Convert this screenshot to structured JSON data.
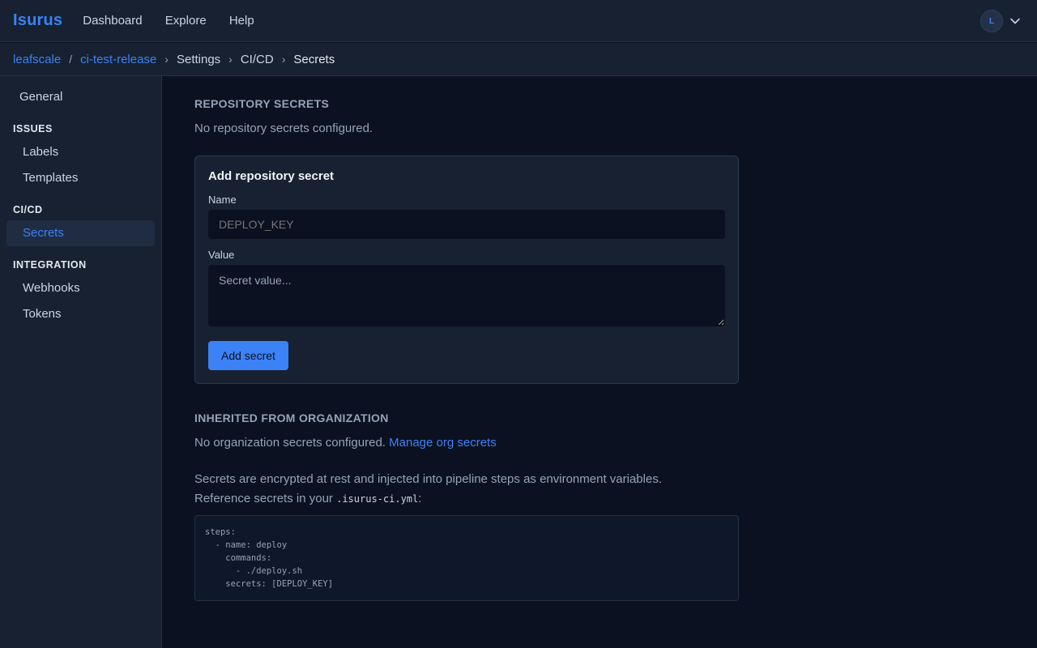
{
  "app": {
    "name": "Isurus"
  },
  "topnav": {
    "items": [
      "Dashboard",
      "Explore",
      "Help"
    ]
  },
  "user": {
    "initial": "L"
  },
  "breadcrumb": {
    "org": "leafscale",
    "repo": "ci-test-release",
    "settings": "Settings",
    "cicd": "CI/CD",
    "current": "Secrets"
  },
  "sidebar": {
    "general": "General",
    "issues_heading": "ISSUES",
    "labels": "Labels",
    "templates": "Templates",
    "cicd_heading": "CI/CD",
    "secrets": "Secrets",
    "integration_heading": "INTEGRATION",
    "webhooks": "Webhooks",
    "tokens": "Tokens"
  },
  "repo_secrets": {
    "title": "REPOSITORY SECRETS",
    "empty": "No repository secrets configured."
  },
  "add_secret": {
    "title": "Add repository secret",
    "name_label": "Name",
    "name_placeholder": "DEPLOY_KEY",
    "value_label": "Value",
    "value_placeholder": "Secret value...",
    "button": "Add secret"
  },
  "inherited": {
    "title": "INHERITED FROM ORGANIZATION",
    "empty": "No organization secrets configured.",
    "manage_link": "Manage org secrets"
  },
  "info": {
    "line1": "Secrets are encrypted at rest and injected into pipeline steps as environment variables.",
    "line2_prefix": "Reference secrets in your",
    "filename": ".isurus-ci.yml",
    "line2_suffix": ":",
    "code": "steps:\n  - name: deploy\n    commands:\n      - ./deploy.sh\n    secrets: [DEPLOY_KEY]"
  },
  "colors": {
    "accent": "#3b82f6",
    "background": "#0b1120",
    "panel": "#172131"
  }
}
